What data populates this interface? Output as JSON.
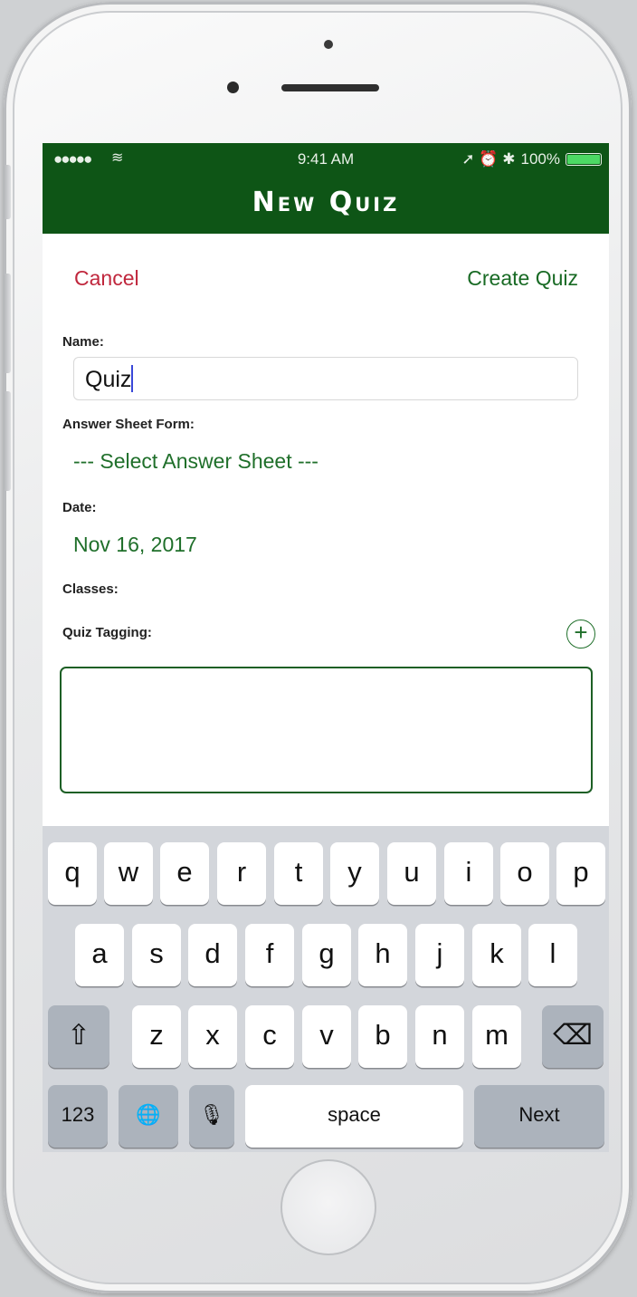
{
  "status_bar": {
    "signal": "●●●●●",
    "wifi": "≋",
    "time": "9:41 AM",
    "indicators": "➚ ⏰ ✱",
    "battery": "100%"
  },
  "nav": {
    "title": "New Quiz"
  },
  "actions": {
    "cancel": "Cancel",
    "create": "Create Quiz"
  },
  "form": {
    "name_label": "Name:",
    "name_value": "Quiz",
    "answer_sheet_label": "Answer Sheet Form:",
    "answer_sheet_value": "--- Select Answer Sheet ---",
    "date_label": "Date:",
    "date_value": "Nov 16, 2017",
    "classes_label": "Classes:",
    "tagging_label": "Quiz Tagging:",
    "add_symbol": "+"
  },
  "keyboard": {
    "row1": [
      "q",
      "w",
      "e",
      "r",
      "t",
      "y",
      "u",
      "i",
      "o",
      "p"
    ],
    "row2": [
      "a",
      "s",
      "d",
      "f",
      "g",
      "h",
      "j",
      "k",
      "l"
    ],
    "row3": [
      "z",
      "x",
      "c",
      "v",
      "b",
      "n",
      "m"
    ],
    "shift": "⇧",
    "delete": "⌫",
    "numbers": "123",
    "globe": "🌐",
    "mic": "🎙",
    "space": "space",
    "next": "Next"
  }
}
